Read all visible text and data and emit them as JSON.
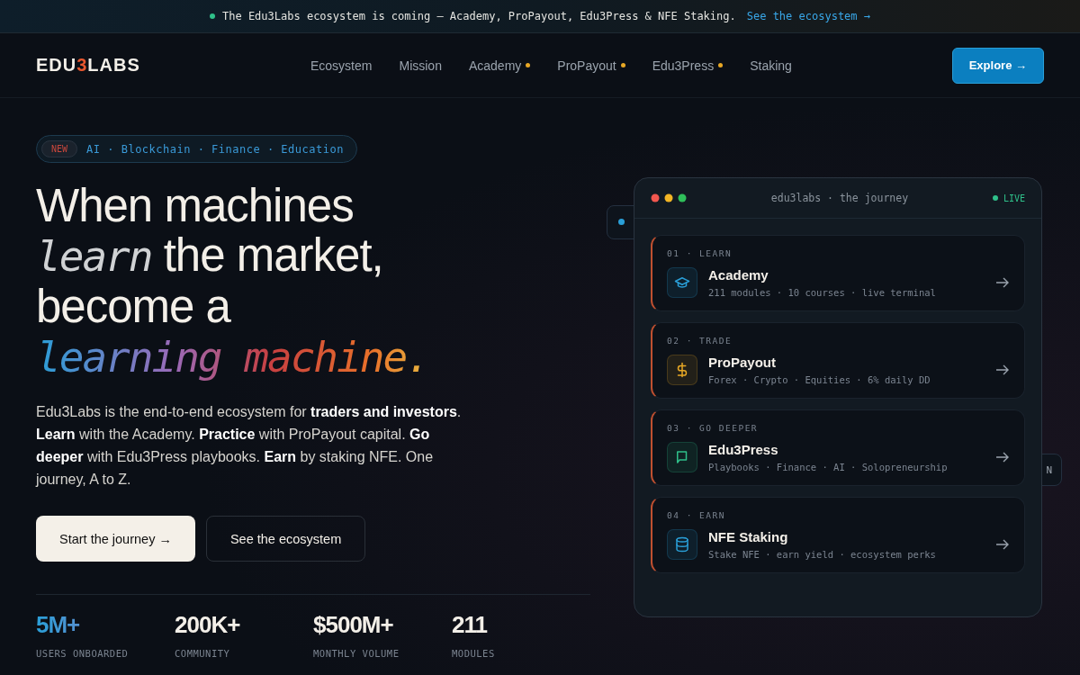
{
  "announcement": {
    "text": "The Edu3Labs ecosystem is coming — Academy, ProPayout, Edu3Press & NFE Staking.",
    "link": "See the ecosystem →"
  },
  "nav": {
    "logo": [
      {
        "text": "EDU",
        "accent": false
      },
      {
        "text": "3",
        "accent": true
      },
      {
        "text": "LABS",
        "accent": false
      }
    ],
    "items": [
      {
        "label": "Ecosystem",
        "dot": false
      },
      {
        "label": "Mission",
        "dot": false
      },
      {
        "label": "Academy",
        "dot": true
      },
      {
        "label": "ProPayout",
        "dot": true
      },
      {
        "label": "Edu3Press",
        "dot": true
      },
      {
        "label": "Staking",
        "dot": false
      }
    ],
    "cta": "Explore →"
  },
  "hero": {
    "badge": {
      "tag": "NEW",
      "text": "AI · Blockchain · Finance · Education"
    },
    "headline": [
      [
        {
          "text": "When machines",
          "kind": "plain"
        }
      ],
      [
        {
          "text": "learn",
          "kind": "mono"
        },
        {
          "text": " the market,",
          "kind": "plain"
        }
      ],
      [
        {
          "text": "become a",
          "kind": "plain"
        }
      ],
      [
        {
          "text": "learning machine.",
          "kind": "gradient"
        }
      ]
    ],
    "description": "Edu3Labs is the end-to-end ecosystem for **traders and investors**. **Learn** with the Academy. **Practice** with ProPayout capital. **Go deeper** with Edu3Press playbooks. **Earn** by staking NFE. One journey, A to Z.",
    "buttons": [
      {
        "label": "Start the journey →",
        "kind": "primary"
      },
      {
        "label": "See the ecosystem",
        "kind": "secondary"
      }
    ],
    "stats": [
      {
        "value": "5M+",
        "label": "USERS ONBOARDED",
        "highlight": true
      },
      {
        "value": "200K+",
        "label": "COMMUNITY",
        "highlight": false
      },
      {
        "value": "$500M+",
        "label": "MONTHLY VOLUME",
        "highlight": false
      },
      {
        "value": "211",
        "label": "MODULES",
        "highlight": false
      }
    ]
  },
  "journey_window": {
    "title": "edu3labs · the journey",
    "status": "LIVE",
    "side_chip": "N",
    "steps": [
      {
        "step": "01 · LEARN",
        "title": "Academy",
        "meta": "211 modules · 10 courses · live terminal",
        "kind": "cap",
        "color": "#2a9fd8"
      },
      {
        "step": "02 · TRADE",
        "title": "ProPayout",
        "meta": "Forex · Crypto · Equities · 6% daily DD",
        "kind": "dollar",
        "color": "#e8a825"
      },
      {
        "step": "03 · GO DEEPER",
        "title": "Edu3Press",
        "meta": "Playbooks · Finance · AI · Solopreneurship",
        "kind": "book",
        "color": "#2fc08a"
      },
      {
        "step": "04 · EARN",
        "title": "NFE Staking",
        "meta": "Stake NFE · earn yield · ecosystem perks",
        "kind": "database",
        "color": "#2a9fd8"
      }
    ]
  }
}
